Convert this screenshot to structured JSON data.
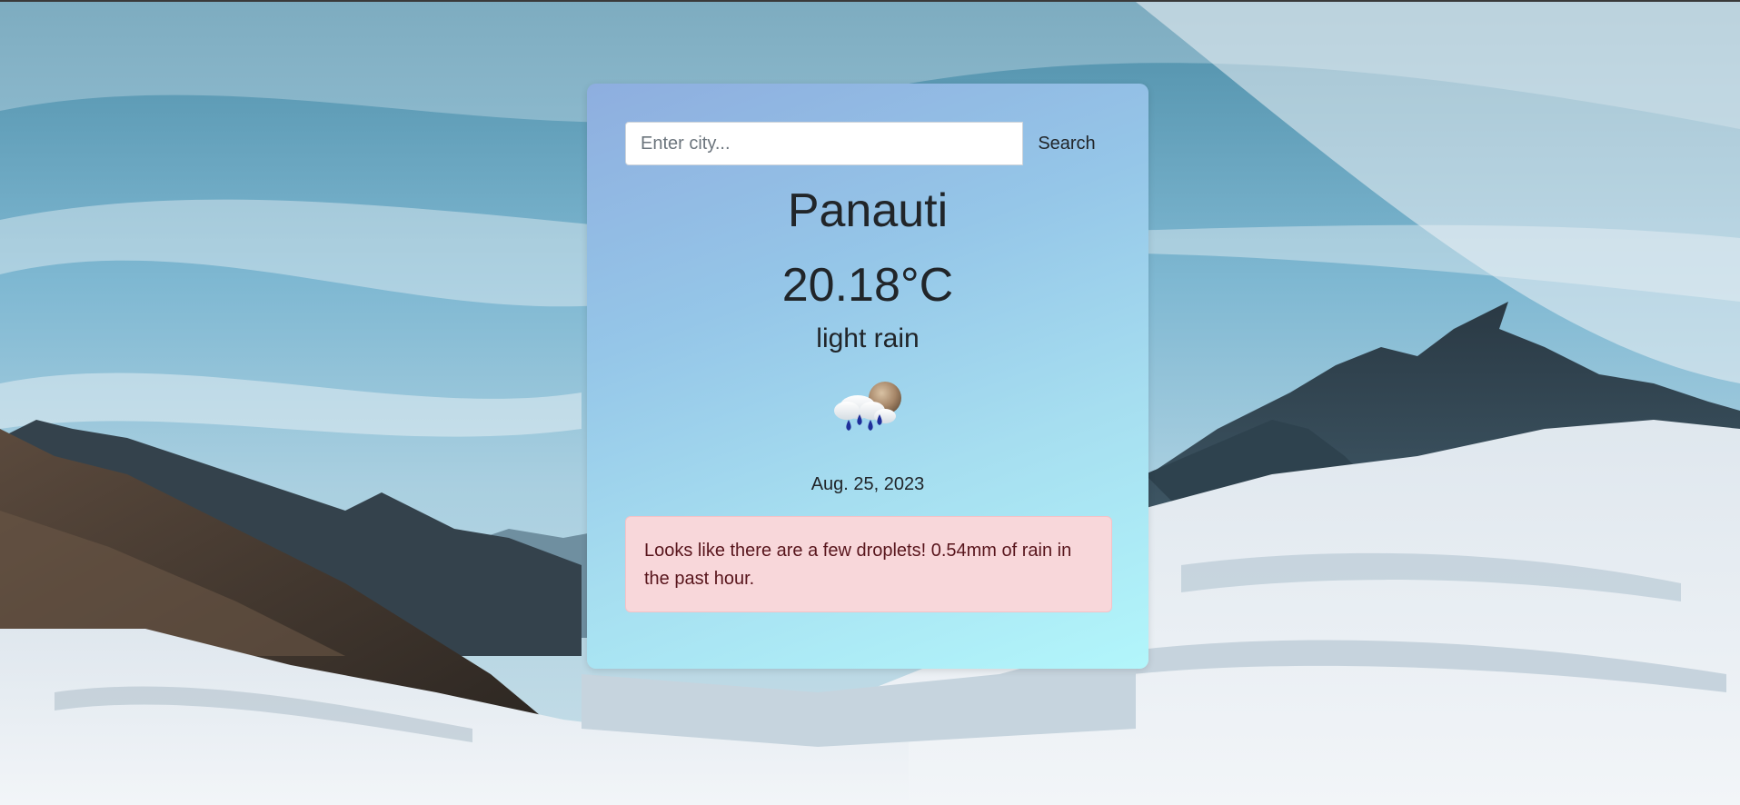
{
  "search": {
    "placeholder": "Enter city...",
    "value": "",
    "button_label": "Search"
  },
  "weather": {
    "city": "Panauti",
    "temperature": "20.18°C",
    "description": "light rain",
    "icon": "rain-cloud-sun-icon",
    "date": "Aug. 25, 2023"
  },
  "alert": {
    "message": "Looks like there are a few droplets! 0.54mm of rain in the past hour."
  },
  "colors": {
    "card_gradient_start": "#8eaedf",
    "card_gradient_end": "#b2f6fb",
    "alert_background": "#f8d7da",
    "alert_text": "#58151c",
    "text": "#212529"
  }
}
